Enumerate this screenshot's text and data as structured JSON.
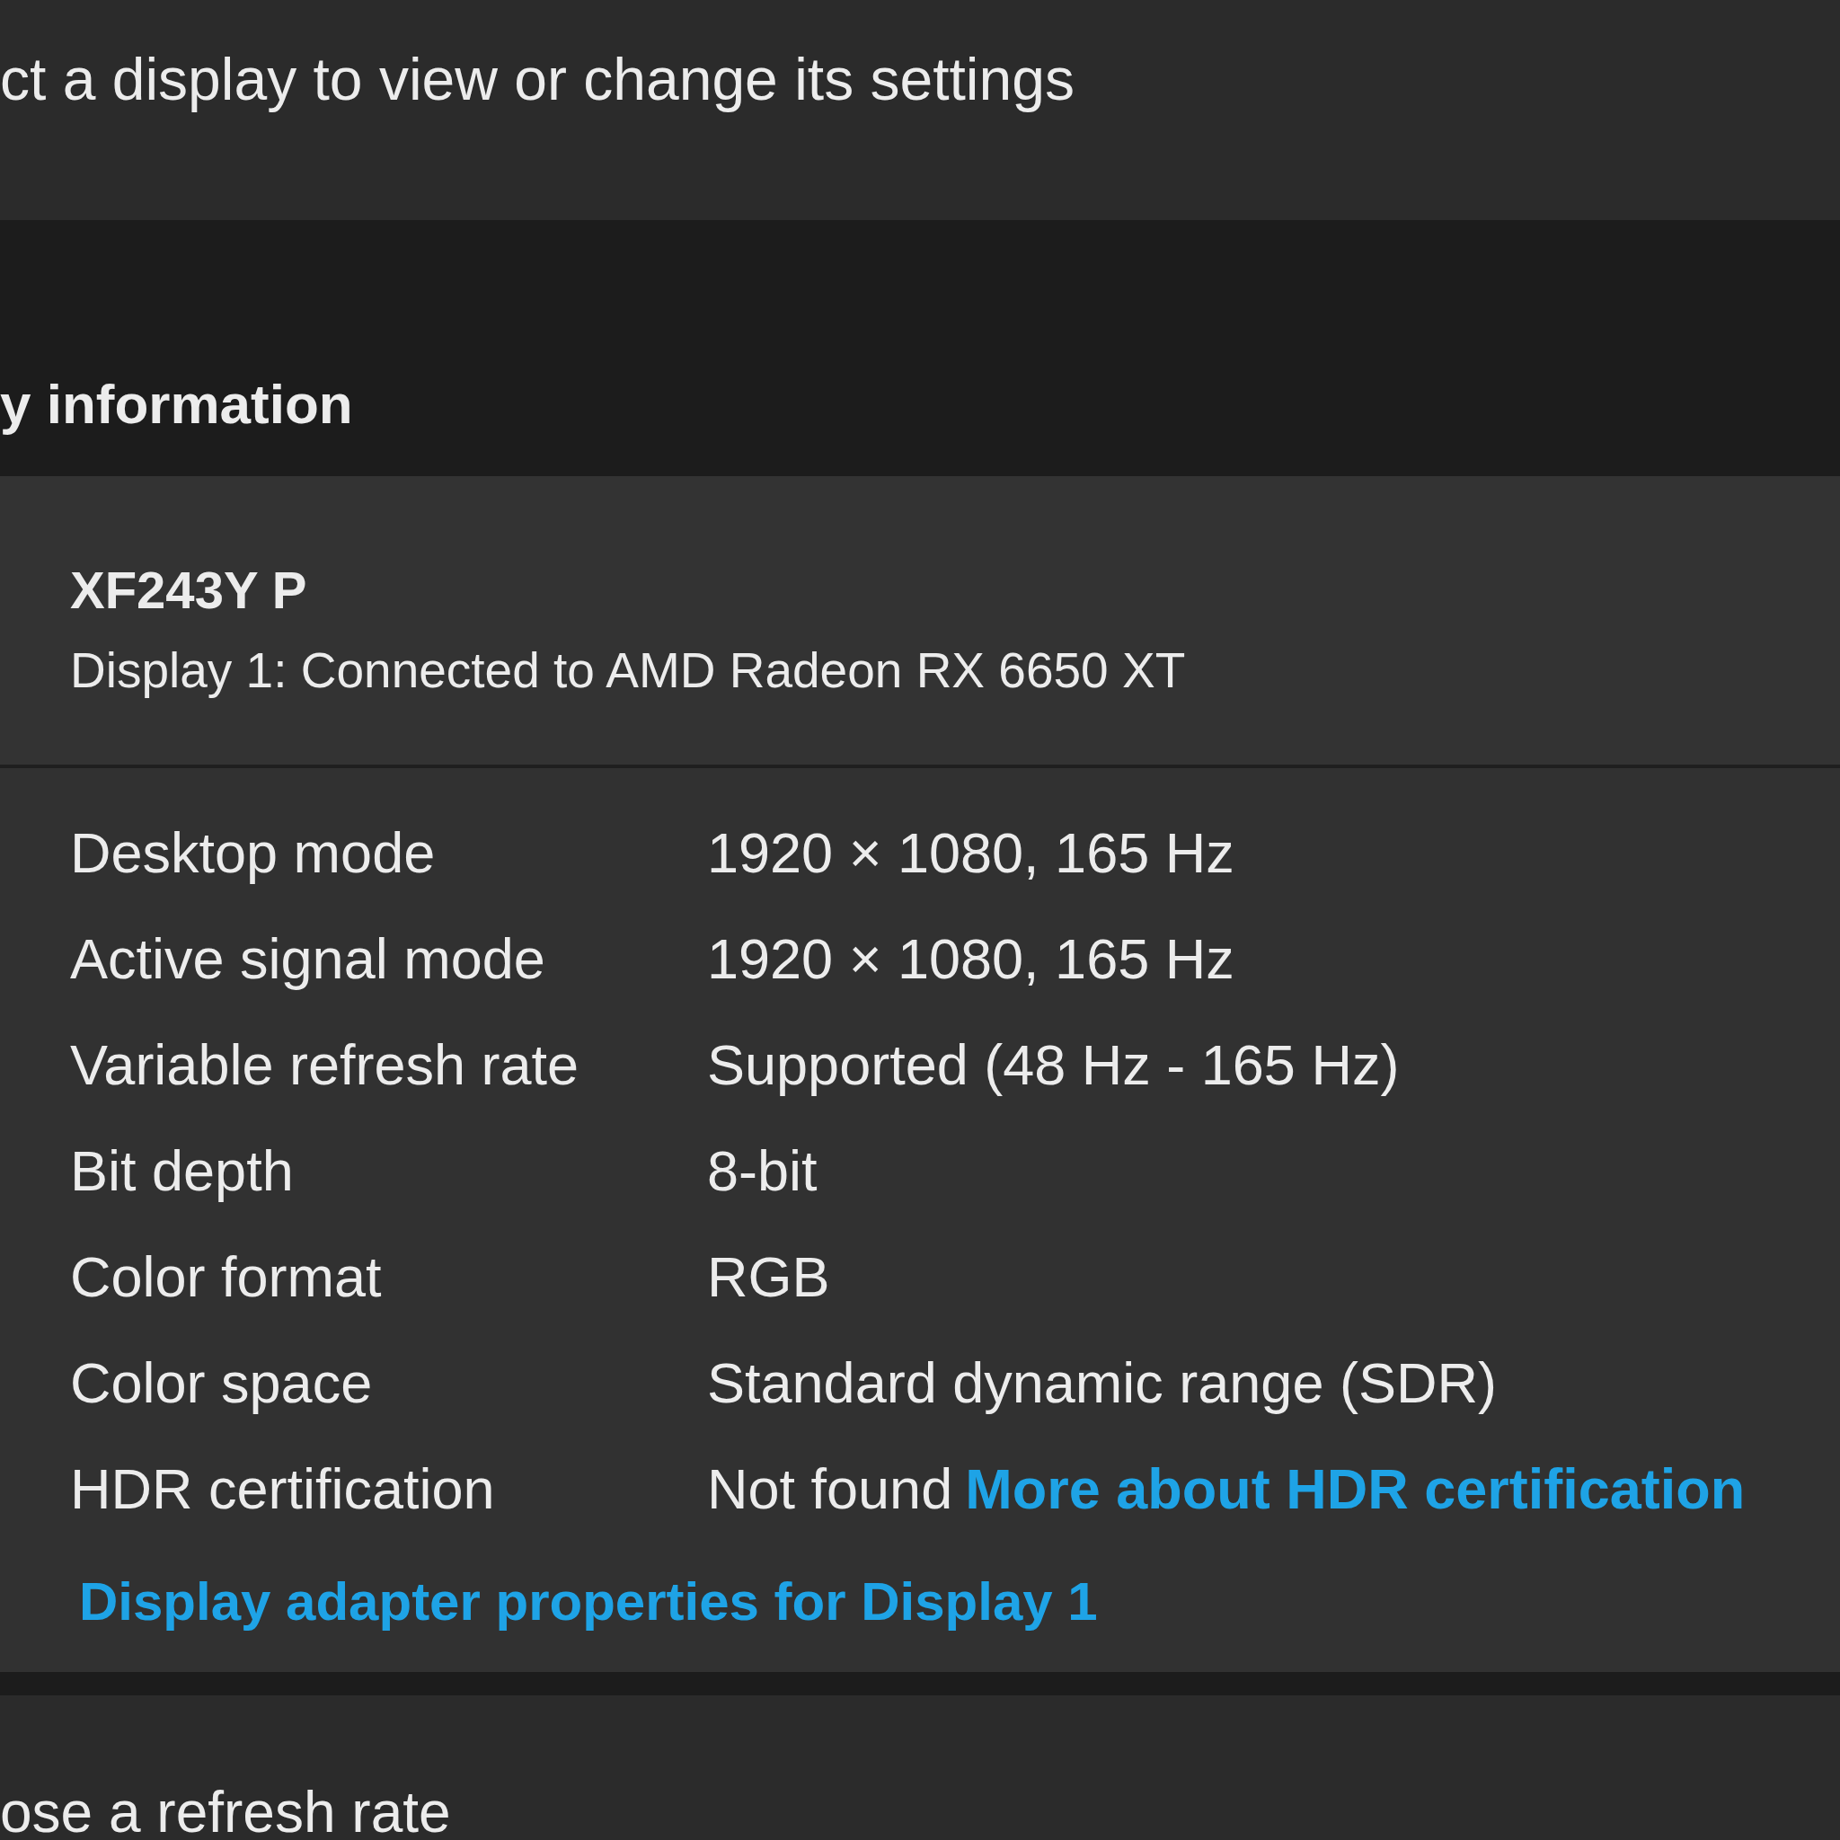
{
  "header": {
    "instruction": "ct a display to view or change its settings"
  },
  "section": {
    "title": "y information"
  },
  "display_card": {
    "name": "XF243Y P",
    "subtitle": "Display 1: Connected to AMD Radeon RX 6650 XT",
    "properties": [
      {
        "label": "Desktop mode",
        "value": "1920 × 1080, 165 Hz"
      },
      {
        "label": "Active signal mode",
        "value": "1920 × 1080, 165 Hz"
      },
      {
        "label": "Variable refresh rate",
        "value": "Supported (48 Hz - 165 Hz)"
      },
      {
        "label": "Bit depth",
        "value": "8-bit"
      },
      {
        "label": "Color format",
        "value": "RGB"
      },
      {
        "label": "Color space",
        "value": "Standard dynamic range (SDR)"
      },
      {
        "label": "HDR certification",
        "value": "Not found",
        "link": "More about HDR certification"
      }
    ],
    "adapter_link": "Display adapter properties for Display 1"
  },
  "next_section": {
    "title": "ose a refresh rate"
  }
}
